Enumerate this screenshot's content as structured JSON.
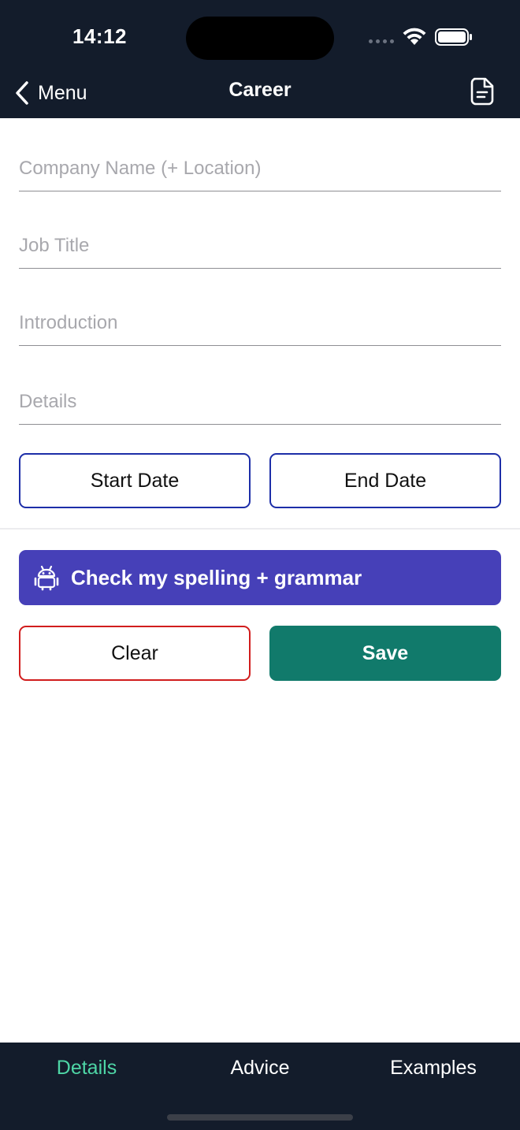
{
  "status_bar": {
    "time": "14:12"
  },
  "nav": {
    "back_label": "Menu",
    "title": "Career",
    "right_icon": "document-icon"
  },
  "form": {
    "company": {
      "placeholder": "Company Name (+ Location)",
      "value": ""
    },
    "job_title": {
      "placeholder": "Job Title",
      "value": ""
    },
    "introduction": {
      "placeholder": "Introduction",
      "value": ""
    },
    "details": {
      "placeholder": "Details",
      "value": ""
    },
    "start_date_label": "Start Date",
    "end_date_label": "End Date"
  },
  "actions": {
    "check_label": "Check my spelling + grammar",
    "check_icon": "robot-icon",
    "clear_label": "Clear",
    "save_label": "Save"
  },
  "tabs": [
    {
      "label": "Details",
      "active": true
    },
    {
      "label": "Advice",
      "active": false
    },
    {
      "label": "Examples",
      "active": false
    }
  ],
  "colors": {
    "header_bg": "#131c2b",
    "accent_tab": "#4ed6a6",
    "date_border": "#1d2ea8",
    "check_bg": "#4640b8",
    "clear_border": "#d11d1d",
    "save_bg": "#117a6b"
  }
}
